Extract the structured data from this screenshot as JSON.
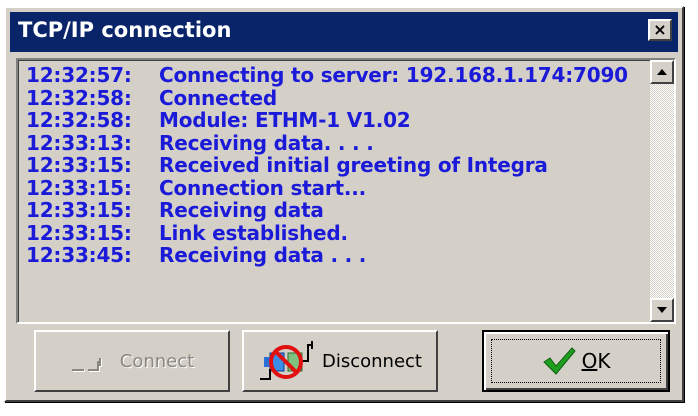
{
  "window": {
    "title": "TCP/IP connection",
    "close_glyph": "×"
  },
  "log": {
    "lines": [
      {
        "time": "12:32:57:",
        "message": "Connecting to server: 192.168.1.174:7090"
      },
      {
        "time": "12:32:58:",
        "message": "Connected"
      },
      {
        "time": "12:32:58:",
        "message": "Module: ETHM-1 V1.02"
      },
      {
        "time": "12:33:13:",
        "message": "Receiving data. . . ."
      },
      {
        "time": "12:33:15:",
        "message": "Received initial greeting of Integra"
      },
      {
        "time": "12:33:15:",
        "message": "Connection start..."
      },
      {
        "time": "12:33:15:",
        "message": "Receiving data"
      },
      {
        "time": "12:33:15:",
        "message": "Link established."
      },
      {
        "time": "12:33:45:",
        "message": "Receiving data . . ."
      }
    ],
    "text_color": "#1a1ad8"
  },
  "buttons": {
    "connect": {
      "label": "Connect",
      "enabled": false,
      "icon": "plug-connect-icon"
    },
    "disconnect": {
      "label": "Disconnect",
      "enabled": true,
      "icon": "no-connection-icon"
    },
    "ok": {
      "label_underlined": "O",
      "label_rest": "K",
      "enabled": true,
      "icon": "checkmark-icon",
      "icon_color": "#1e9e1e"
    }
  },
  "colors": {
    "titlebar": "#0a246a",
    "face": "#d4d0c8"
  }
}
